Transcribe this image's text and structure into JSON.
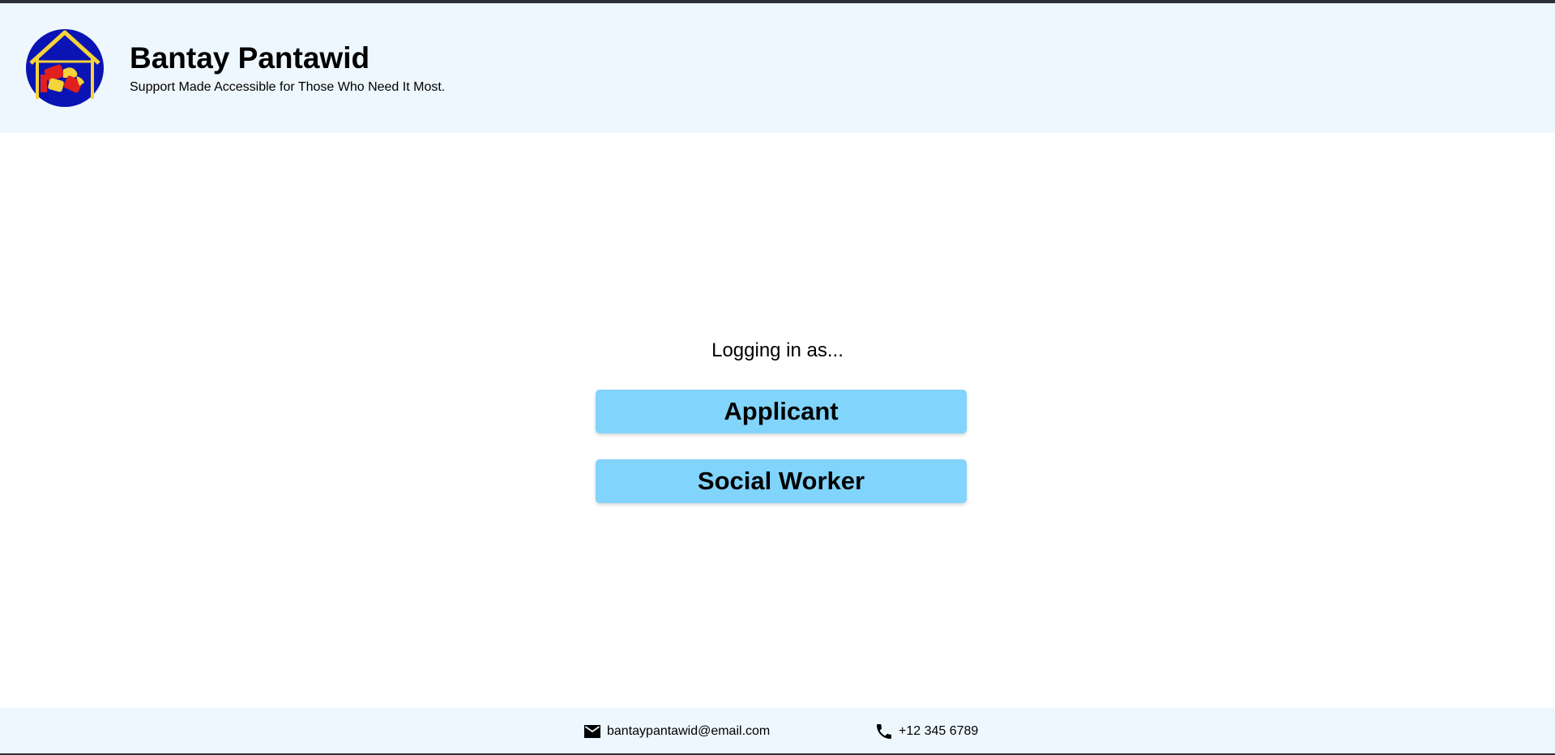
{
  "header": {
    "title": "Bantay Pantawid",
    "tagline": "Support Made Accessible for Those Who Need It Most.",
    "logo_icon": "house-hands-logo-icon"
  },
  "login": {
    "prompt": "Logging in as...",
    "roles": [
      {
        "label": "Applicant"
      },
      {
        "label": "Social Worker"
      }
    ]
  },
  "footer": {
    "email": "bantaypantawid@email.com",
    "email_icon": "mail-icon",
    "phone": "+12 345 6789",
    "phone_icon": "phone-icon"
  },
  "colors": {
    "header_bg": "#eef7fe",
    "button_bg": "#81d4fb",
    "logo_blue": "#0a14b4",
    "logo_yellow": "#f5d33a",
    "logo_red": "#e0201c"
  }
}
